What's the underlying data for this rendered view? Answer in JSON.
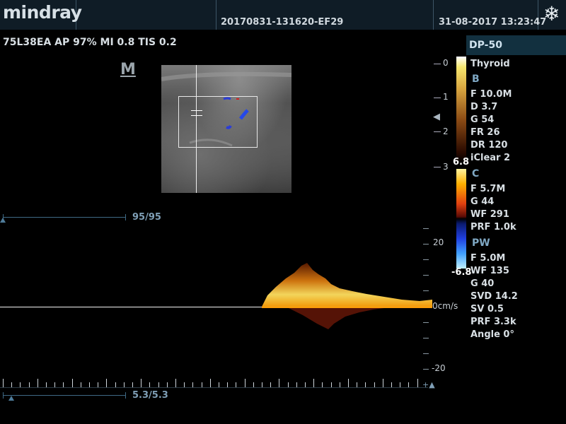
{
  "header": {
    "brand": "mindray",
    "study_id": "20170831-131620-EF29",
    "datetime": "31-08-2017  13:23:47",
    "freeze_icon": "snowflake-icon"
  },
  "probe_line": "75L38EA  AP 97%  MI 0.8 TIS 0.2",
  "m_icon_label": "M",
  "depth_scale": [
    "0",
    "1",
    "2",
    "3"
  ],
  "color_scale": {
    "top": "6.8",
    "bottom": "-6.8"
  },
  "panel": {
    "preset": "DP-50",
    "exam": "Thyroid",
    "b_title": "B",
    "b_params": [
      "F 10.0M",
      "D 3.7",
      "G 54",
      "FR 26",
      "DR 120",
      "iClear 2"
    ],
    "c_title": "C",
    "c_params": [
      "F 5.7M",
      "G 44",
      "WF 291",
      "PRF 1.0k"
    ],
    "pw_title": "PW",
    "pw_params": [
      "F 5.0M",
      "WF 135",
      "G 40",
      "SVD 14.2",
      "SV 0.5",
      "PRF 3.3k",
      "Angle 0°"
    ]
  },
  "sliders": {
    "top_value": "95/95",
    "top_fill": 1.0,
    "bottom_value": "5.3/5.3",
    "bottom_fill": 1.0
  },
  "velocity_scale": {
    "top": "20",
    "zero": "0cm/s",
    "bottom": "-20"
  },
  "time_axis_end": "+▲",
  "colors": {
    "topbar_bg": "#0f1c26",
    "panel_header_bg": "#12303f",
    "slider_color": "#3f6a86",
    "section_label": "#7fa8c4"
  }
}
